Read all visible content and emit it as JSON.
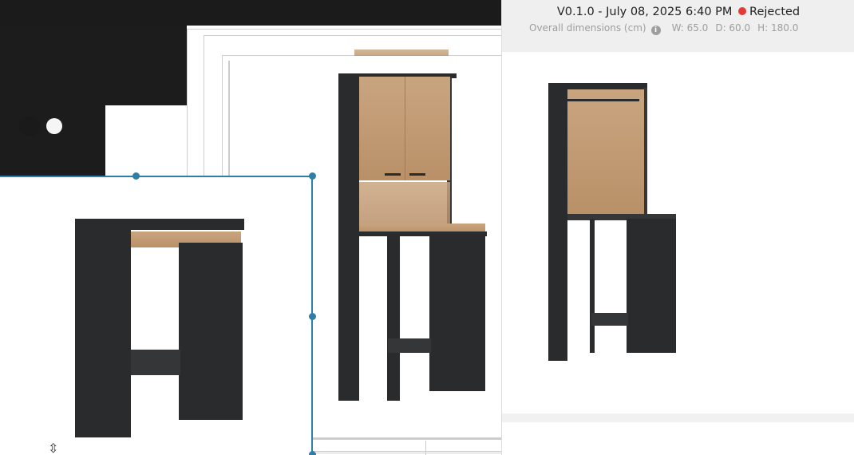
{
  "header": {
    "version": "V0.1.0",
    "separator": " - ",
    "date": "July 08, 2025 6:40 PM",
    "status": "Rejected",
    "status_color": "#e53935"
  },
  "dimensions": {
    "label": "Overall dimensions (cm)",
    "width": "W: 65.0",
    "depth": "D: 60.0",
    "height": "H: 180.0"
  },
  "colors": {
    "accent": "#2f7ea8",
    "furniture_dark": "#2a2b2d",
    "furniture_wood": "#c19a72"
  },
  "icons": {
    "cursor": "resize-vertical-cursor-icon",
    "info": "info-icon"
  }
}
